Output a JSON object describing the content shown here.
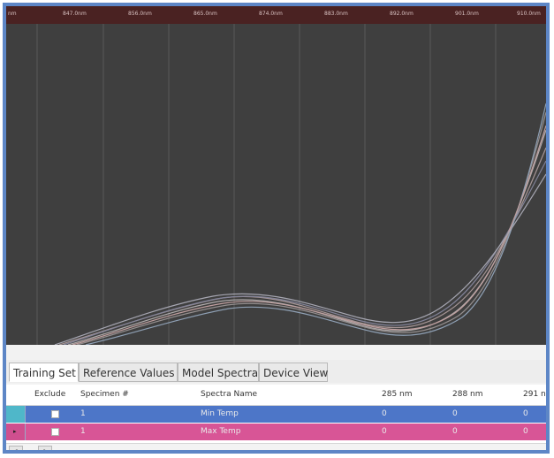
{
  "plot": {
    "wavelength_ticks": [
      "nm",
      "847.0nm",
      "856.0nm",
      "865.0nm",
      "874.0nm",
      "883.0nm",
      "892.0nm",
      "901.0nm",
      "910.0nm"
    ],
    "background": "#3f3f3f",
    "topbar_color": "#4a2222"
  },
  "tabs": [
    {
      "label": "Training Set",
      "active": true
    },
    {
      "label": "Reference Values",
      "active": false
    },
    {
      "label": "Model Spectra",
      "active": false
    },
    {
      "label": "Device View",
      "active": false
    }
  ],
  "table": {
    "columns": [
      "Exclude",
      "Specimen #",
      "Spectra Name",
      "285 nm",
      "288 nm",
      "291 nm"
    ],
    "rows": [
      {
        "specimen": "1",
        "name": "Min Temp",
        "v285": "0",
        "v288": "0",
        "v291": "0",
        "color": "#4d76c8"
      },
      {
        "specimen": "1",
        "name": "Max Temp",
        "v285": "0",
        "v288": "0",
        "v291": "0",
        "color": "#d85596"
      }
    ]
  },
  "icons": {
    "row_pointer": "triangle-right-icon",
    "scroll_left": "chevron-left-icon",
    "scroll_right": "chevron-right-icon"
  }
}
